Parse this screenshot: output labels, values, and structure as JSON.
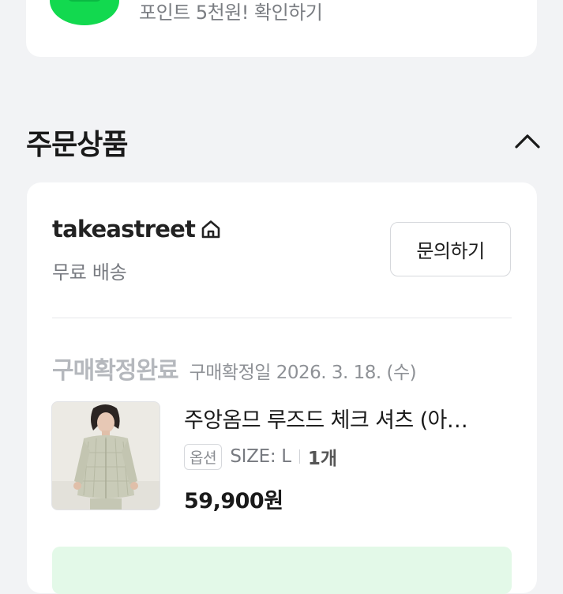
{
  "promo": {
    "text": "포인트 5천원! 확인하기",
    "badge_icon": "point-badge-icon",
    "accent_color": "#12d94f"
  },
  "section": {
    "title": "주문상품",
    "toggle_icon": "chevron-up-icon"
  },
  "store": {
    "name": "takeastreet",
    "home_icon": "home-icon",
    "shipping": "무료 배송",
    "inquiry_button": "문의하기"
  },
  "order": {
    "status": "구매확정완료",
    "date_text": "구매확정일 2026. 3. 18. (수)"
  },
  "product": {
    "name": "주앙옴므 루즈드 체크 셔츠 (아…",
    "option_badge": "옵션",
    "size": "SIZE: L",
    "quantity": "1개",
    "price": "59,900원"
  },
  "colors": {
    "banner": "#e3f9e8",
    "status_gray": "#b5b8bd"
  }
}
